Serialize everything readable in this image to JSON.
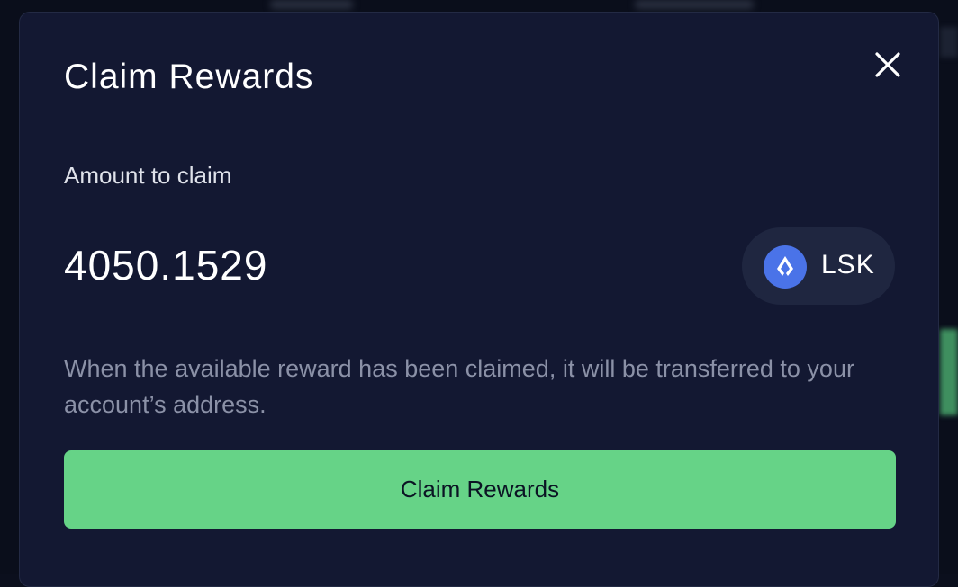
{
  "modal": {
    "title": "Claim Rewards",
    "amount_label": "Amount to claim",
    "amount_value": "4050.1529",
    "token": {
      "symbol": "LSK",
      "icon": "lisk-logo-icon",
      "icon_color": "#4a73e8"
    },
    "info_text": "When the available reward has been claimed, it will be transferred to your account’s address.",
    "claim_button_label": "Claim Rewards",
    "close_icon": "close-icon"
  },
  "colors": {
    "modal_bg": "#131832",
    "accent_green": "#66d387",
    "muted_text": "#8b91a7",
    "pill_bg": "#1f2640"
  }
}
